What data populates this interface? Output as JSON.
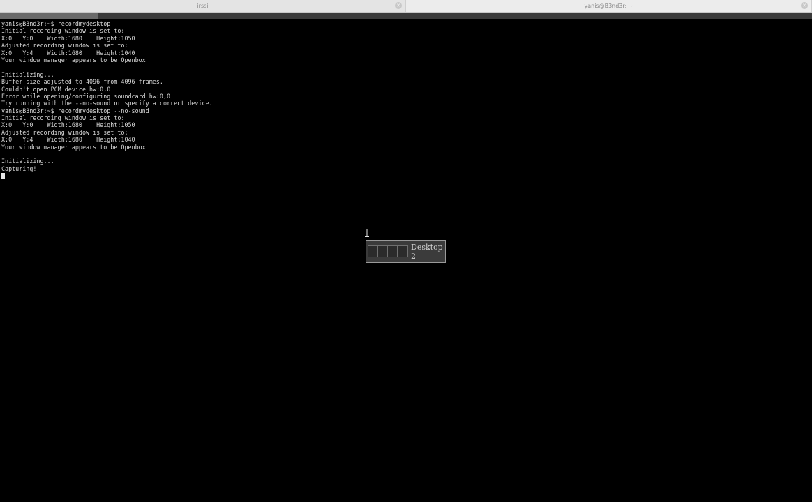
{
  "tabs": [
    {
      "title": "irssi",
      "active": false
    },
    {
      "title": "yanis@B3nd3r: ~",
      "active": true
    }
  ],
  "terminal": {
    "lines": [
      "yanis@B3nd3r:~$ recordmydesktop",
      "Initial recording window is set to:",
      "X:0   Y:0    Width:1680    Height:1050",
      "Adjusted recording window is set to:",
      "X:0   Y:4    Width:1680    Height:1040",
      "Your window manager appears to be Openbox",
      "",
      "Initializing...",
      "Buffer size adjusted to 4096 from 4096 frames.",
      "Couldn't open PCM device hw:0,0",
      "Error while opening/configuring soundcard hw:0,0",
      "Try running with the --no-sound or specify a correct device.",
      "yanis@B3nd3r:~$ recordmydesktop --no-sound",
      "Initial recording window is set to:",
      "X:0   Y:0    Width:1680    Height:1050",
      "Adjusted recording window is set to:",
      "X:0   Y:4    Width:1680    Height:1040",
      "Your window manager appears to be Openbox",
      "",
      "Initializing...",
      "Capturing!"
    ]
  },
  "desktop_switcher": {
    "label": "Desktop 2",
    "desktop_count": 4
  },
  "colors": {
    "terminal_bg": "#000000",
    "terminal_fg": "#d8d8d8",
    "tabbar_bg": "#e4e4e4",
    "popup_bg": "#3b3b3b"
  }
}
